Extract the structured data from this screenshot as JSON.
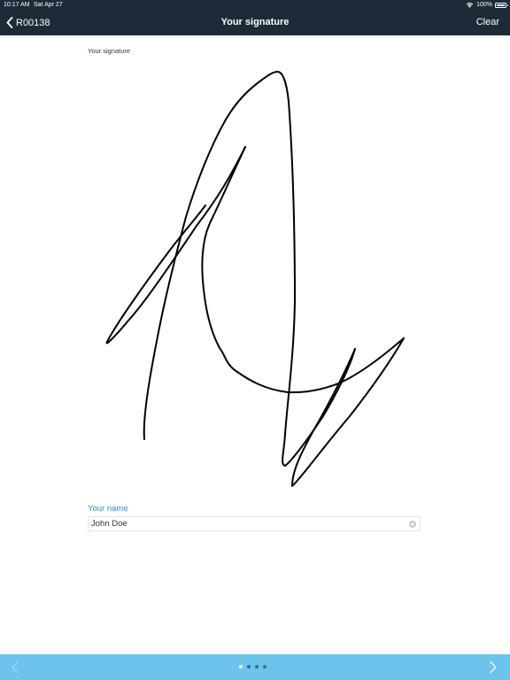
{
  "status_bar": {
    "time": "10:17 AM",
    "date": "Sat Apr 27",
    "battery": "100%",
    "battery_level": 1.0
  },
  "nav": {
    "back_label": "R00138",
    "title": "Your signature",
    "clear_label": "Clear"
  },
  "signature": {
    "label": "Your signature"
  },
  "name_field": {
    "label": "Your name",
    "value": "John Doe"
  },
  "pagination": {
    "total_pages": 4,
    "current_page": 1
  },
  "colors": {
    "nav_background": "#1d2a38",
    "accent": "#2a8fd6",
    "bottom_bar": "#6cc3ec"
  },
  "icons": {
    "back": "chevron-left-icon",
    "wifi": "wifi-icon",
    "battery": "battery-icon",
    "clear_field": "clear-circle-icon",
    "prev": "chevron-left-icon",
    "next": "chevron-right-icon"
  }
}
